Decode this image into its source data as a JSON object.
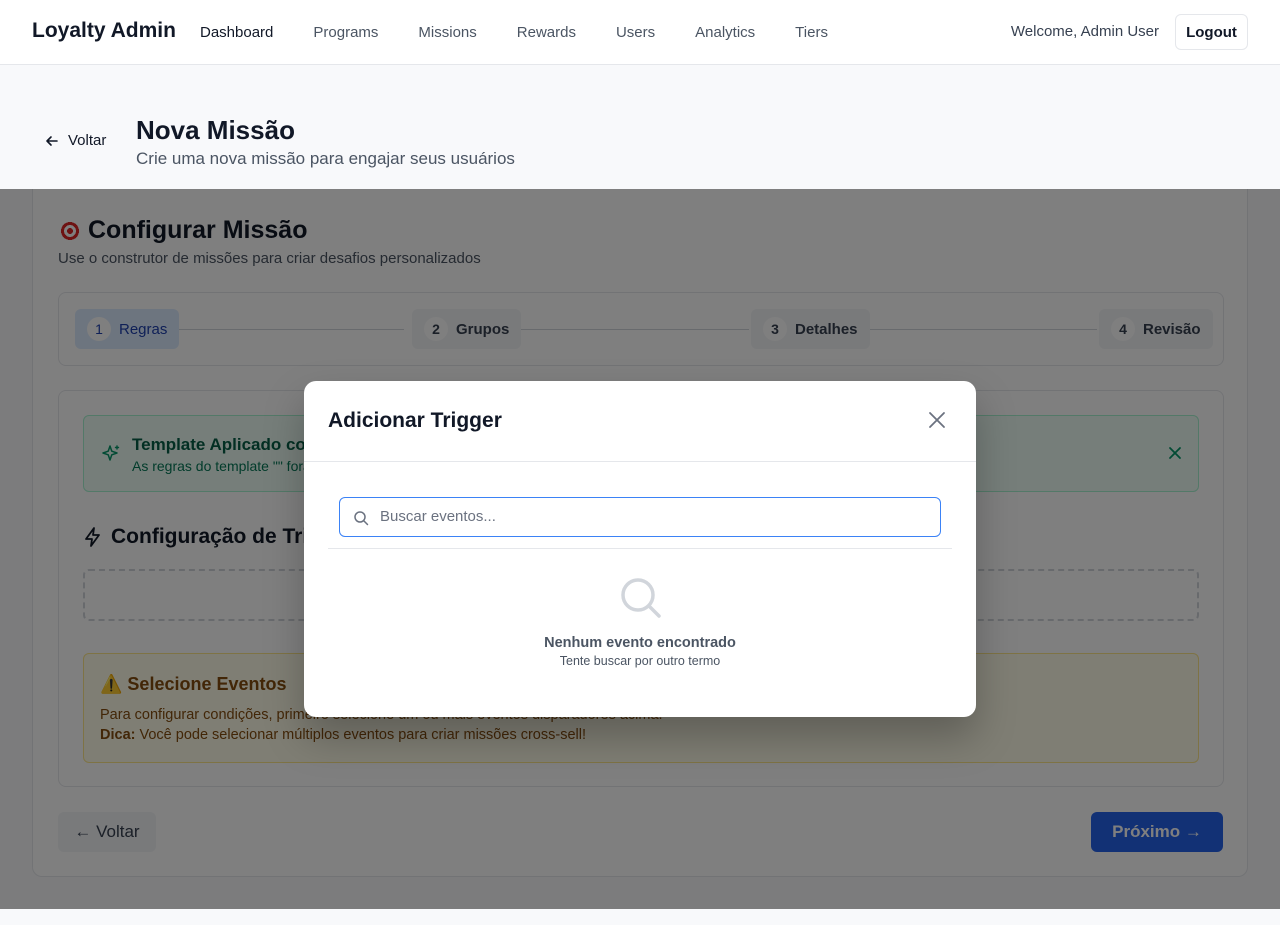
{
  "nav": {
    "brand": "Loyalty Admin",
    "links": [
      "Dashboard",
      "Programs",
      "Missions",
      "Rewards",
      "Users",
      "Analytics",
      "Tiers"
    ],
    "welcome": "Welcome, Admin User",
    "logout": "Logout"
  },
  "header": {
    "back": "Voltar",
    "title": "Nova Missão",
    "subtitle": "Crie uma nova missão para engajar seus usuários"
  },
  "card": {
    "title": "Configurar Missão",
    "subtitle": "Use o construtor de missões para criar desafios personalizados",
    "steps": [
      {
        "num": "1",
        "label": "Regras"
      },
      {
        "num": "2",
        "label": "Grupos"
      },
      {
        "num": "3",
        "label": "Detalhes"
      },
      {
        "num": "4",
        "label": "Revisão"
      }
    ],
    "template_alert": {
      "title": "Template Aplicado com Sucesso",
      "text": "As regras do template \"\" foram carregadas"
    },
    "trigger_title": "Configuração de Triggers",
    "warning": {
      "icon": "⚠️",
      "title": "Selecione Eventos",
      "text": "Para configurar condições, primeiro selecione um ou mais eventos disparadores acima.",
      "tip_label": "Dica:",
      "tip_text": " Você pode selecionar múltiplos eventos para criar missões cross-sell!"
    },
    "back_button": "← Voltar",
    "next_button": "Próximo →"
  },
  "modal": {
    "title": "Adicionar Trigger",
    "search_placeholder": "Buscar eventos...",
    "search_value": "",
    "empty_title": "Nenhum evento encontrado",
    "empty_sub": "Tente buscar por outro termo"
  },
  "colors": {
    "primary": "#2563eb",
    "success_bg": "#ecfdf5",
    "warning_bg": "#fefce8",
    "overlay": "rgba(0,0,0,0.5)"
  }
}
